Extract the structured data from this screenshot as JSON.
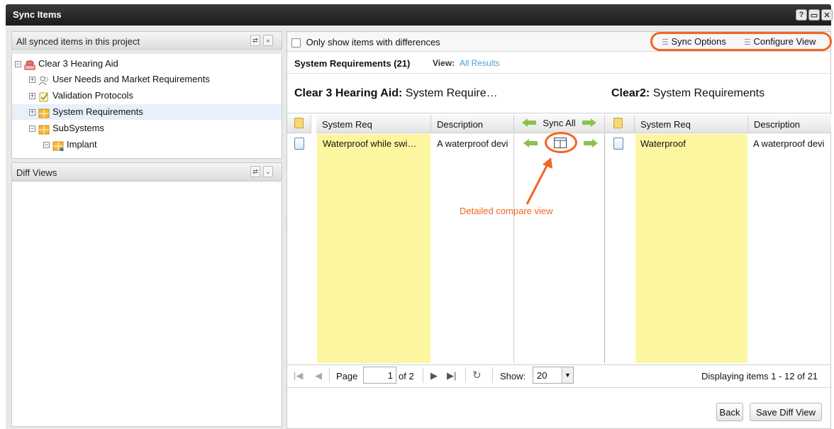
{
  "window": {
    "title": "Sync Items",
    "help_icon": "help-icon",
    "minimize_icon": "minimize-icon",
    "close_icon": "close-icon"
  },
  "left": {
    "tree_header": "All synced items in this project",
    "tree": [
      {
        "label": "Clear 3 Hearing Aid",
        "icon": "project-icon",
        "expander": "−"
      },
      {
        "label": "User Needs and Market Requirements",
        "icon": "user-needs-icon",
        "expander": "+"
      },
      {
        "label": "Validation Protocols",
        "icon": "validation-icon",
        "expander": "+"
      },
      {
        "label": "System Requirements",
        "icon": "requirements-icon",
        "expander": "+"
      },
      {
        "label": "SubSystems",
        "icon": "subsystems-icon",
        "expander": "−"
      },
      {
        "label": "Implant",
        "icon": "implant-icon",
        "expander": "−"
      }
    ],
    "diff_header": "Diff Views"
  },
  "main": {
    "only_diff_label": "Only show items with differences",
    "sync_options": "Sync Options",
    "configure_view": "Configure View",
    "section_title": "System Requirements (21)",
    "view_label": "View:",
    "view_value": "All Results",
    "left_heading_bold": "Clear 3 Hearing Aid:",
    "left_heading_rest": " System Require…",
    "right_heading_bold": "Clear2:",
    "right_heading_rest": " System Requirements",
    "columns": {
      "sys_req": "System Req",
      "description": "Description",
      "sync_all": "Sync All"
    },
    "row": {
      "left_req": "Waterproof while swi…",
      "left_desc": "A waterproof devi",
      "right_req": "Waterproof",
      "right_desc": "A waterproof devi"
    },
    "annotation": "Detailed compare view",
    "pager": {
      "page_label": "Page",
      "page_value": "1",
      "of_label": "of 2",
      "show_label": "Show:",
      "show_value": "20",
      "displaying": "Displaying items 1 - 12 of 21"
    },
    "back_button": "Back",
    "save_button": "Save Diff View"
  },
  "colors": {
    "highlight": "#fdf6a0",
    "annotation": "#f26522",
    "link": "#4a9fd8",
    "titlebar": "#262626"
  }
}
